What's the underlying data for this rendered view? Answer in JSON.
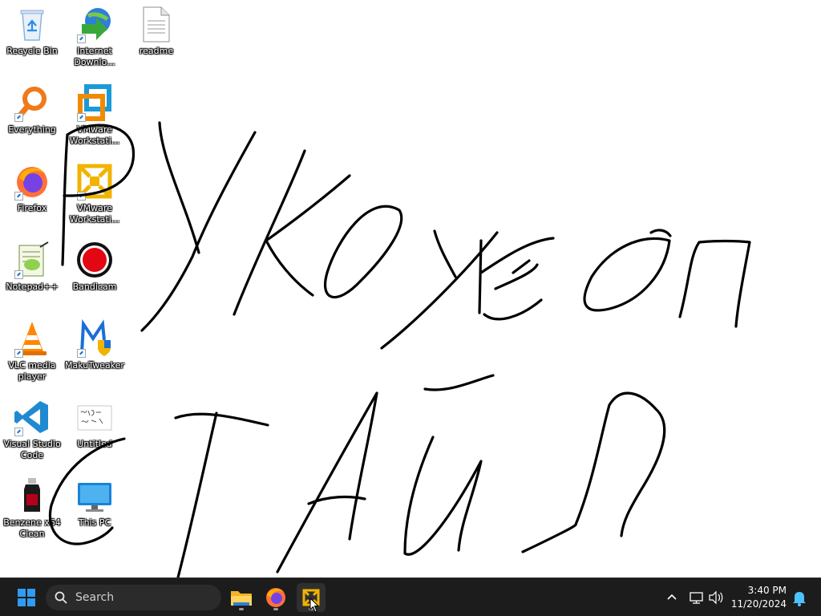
{
  "desktop": {
    "icons": [
      {
        "label": "Recycle Bin"
      },
      {
        "label": "Internet Downlo..."
      },
      {
        "label": "readme"
      },
      {
        "label": "Everything"
      },
      {
        "label": "VMware Workstati..."
      },
      {
        "label": "Firefox"
      },
      {
        "label": "VMware Workstati..."
      },
      {
        "label": "Notepad++"
      },
      {
        "label": "Bandicam"
      },
      {
        "label": "VLC media player"
      },
      {
        "label": "MakuTweaker"
      },
      {
        "label": "Visual Studio Code"
      },
      {
        "label": "Untitled"
      },
      {
        "label": "Benzene x64 Clean"
      },
      {
        "label": "This PC"
      }
    ]
  },
  "taskbar": {
    "search": {
      "label": "Search"
    },
    "apps": [
      {
        "icon": "file-explorer-icon"
      },
      {
        "icon": "firefox-icon"
      },
      {
        "icon": "vmware-icon",
        "active": true
      }
    ],
    "tray": {
      "time": "3:40 PM",
      "date": "11/20/2024"
    }
  },
  "colors": {
    "taskbar_bg": "#1c1c1c",
    "desktop_bg": "#ffffff",
    "start_blue": "#2f9bf2",
    "ink": "#000000"
  }
}
